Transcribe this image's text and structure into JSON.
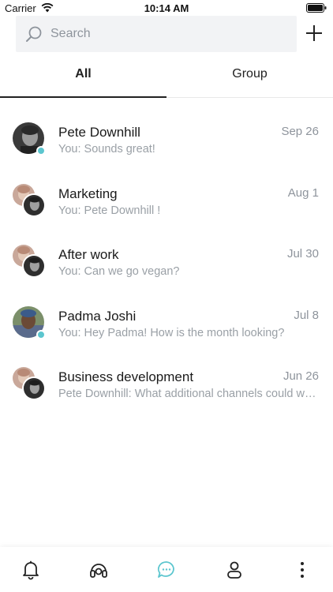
{
  "status_bar": {
    "carrier": "Carrier",
    "time": "10:14 AM"
  },
  "search": {
    "placeholder": "Search"
  },
  "tabs": [
    {
      "label": "All",
      "active": true
    },
    {
      "label": "Group",
      "active": false
    }
  ],
  "chats": [
    {
      "name": "Pete Downhill",
      "preview": "You: Sounds great!",
      "date": "Sep 26",
      "type": "single",
      "online": true
    },
    {
      "name": "Marketing",
      "preview": "You: Pete Downhill !",
      "date": "Aug 1",
      "type": "group",
      "online": false
    },
    {
      "name": "After work",
      "preview": "You: Can we go vegan?",
      "date": "Jul 30",
      "type": "group",
      "online": false
    },
    {
      "name": "Padma Joshi",
      "preview": "You: Hey Padma! How is the month looking?",
      "date": "Jul 8",
      "type": "single",
      "online": true
    },
    {
      "name": "Business development",
      "preview": "Pete Downhill: What additional channels could we use to reach new customers?",
      "date": "Jun 26",
      "type": "group",
      "online": false
    }
  ],
  "bottom_nav": [
    {
      "icon": "bell-icon",
      "active": false
    },
    {
      "icon": "headset-icon",
      "active": false
    },
    {
      "icon": "chat-bubble-icon",
      "active": true
    },
    {
      "icon": "person-icon",
      "active": false
    },
    {
      "icon": "more-vertical-icon",
      "active": false
    }
  ],
  "colors": {
    "accent": "#5cc6cf",
    "text": "#1a1a1a",
    "muted": "#9aa0a6",
    "search_bg": "#f2f3f5"
  }
}
